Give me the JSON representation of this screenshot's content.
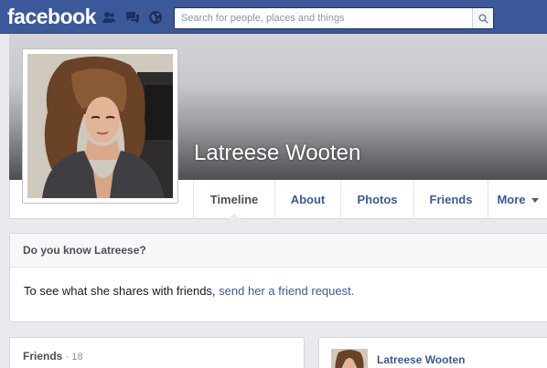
{
  "header": {
    "logo": "facebook",
    "search_placeholder": "Search for people, places and things",
    "jewels": [
      "friend-requests-icon",
      "messages-icon",
      "notifications-globe-icon"
    ],
    "colors": {
      "bar": "#3b5998",
      "link": "#3b5998"
    }
  },
  "profile": {
    "name": "Latreese Wooten"
  },
  "tabs": [
    {
      "label": "Timeline",
      "active": true
    },
    {
      "label": "About"
    },
    {
      "label": "Photos"
    },
    {
      "label": "Friends"
    },
    {
      "label": "More"
    }
  ],
  "know_box": {
    "title": "Do you know Latreese?",
    "body_text": "To see what she shares with friends, ",
    "link_text": "send her a friend request."
  },
  "friends_box": {
    "title": "Friends",
    "count": "· 18"
  },
  "post": {
    "author": "Latreese Wooten"
  }
}
